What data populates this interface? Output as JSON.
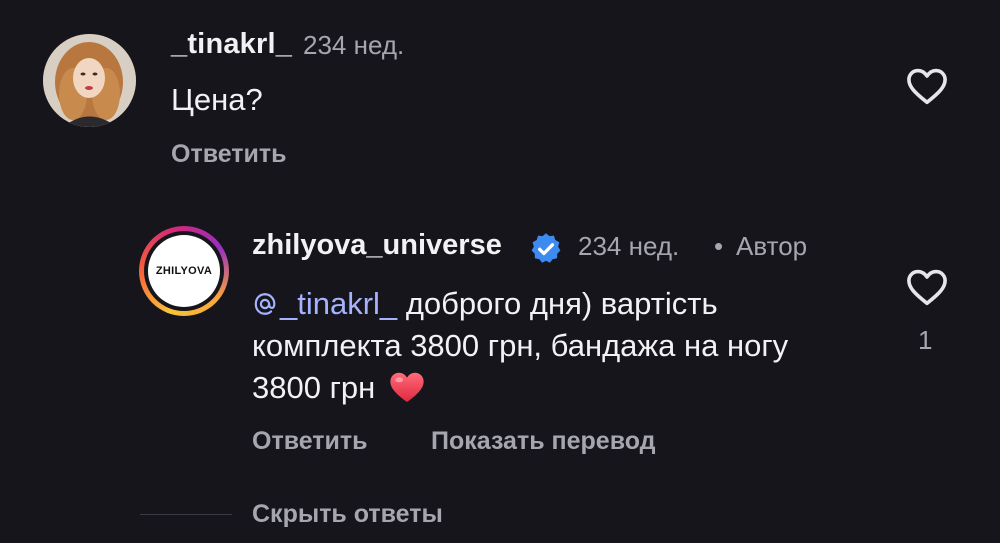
{
  "comment": {
    "username": "_tinakrl_",
    "time": "234 нед.",
    "text": "Цена?",
    "reply_label": "Ответить"
  },
  "reply": {
    "avatar_label": "ZHILYOVA",
    "username": "zhilyova_universe",
    "time": "234 нед.",
    "separator": "•",
    "author_label": "Автор",
    "mention": "_tinakrl_",
    "text": "доброго дня) вартість комплекта 3800 грн, бандажа на ногу 3800 грн",
    "emoji": "red-heart",
    "reply_label": "Ответить",
    "translate_label": "Показать перевод",
    "like_count": "1"
  },
  "thread": {
    "hide_replies_label": "Скрыть ответы"
  },
  "colors": {
    "background": "#15151b",
    "primary_text": "#f2f2f4",
    "secondary_text": "#a6a6ae",
    "mention": "#a5b3ff",
    "verified": "#3d8bf0"
  }
}
